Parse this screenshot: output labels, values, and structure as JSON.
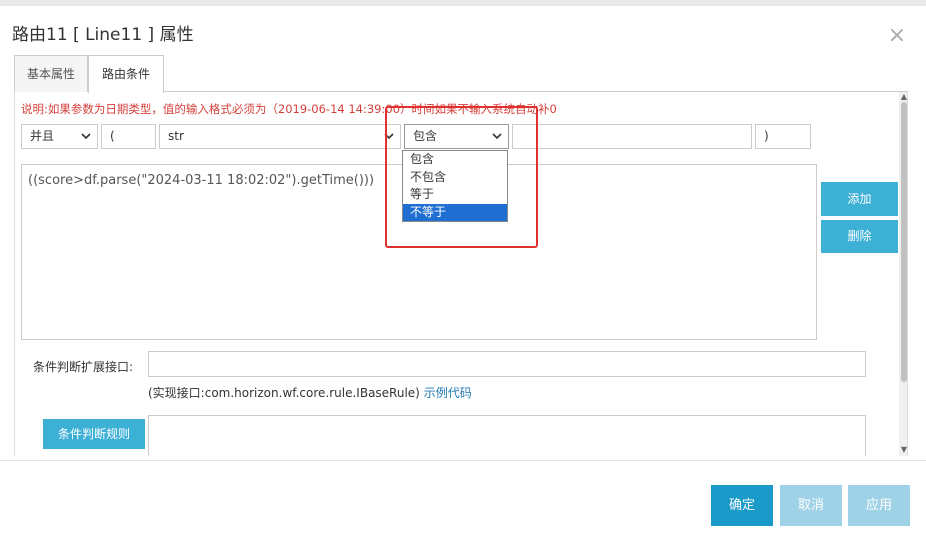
{
  "dialog": {
    "title": "路由11 [ Line11 ] 属性"
  },
  "tabs": [
    {
      "label": "基本属性",
      "active": false
    },
    {
      "label": "路由条件",
      "active": true
    }
  ],
  "note": "说明:如果参数为日期类型，值的输入格式必须为（2019-06-14 14:39:00）时间如果不输入系统自动补0",
  "condition_row": {
    "logic_value": "并且",
    "left_paren": "(",
    "variable_value": "str",
    "operator_value": "包含",
    "compare_value": "",
    "right_paren": ")"
  },
  "operator_options": [
    "包含",
    "不包含",
    "等于",
    "不等于"
  ],
  "operator_highlighted": "不等于",
  "expression_text": "((score>df.parse(\"2024-03-11 18:02:02\").getTime()))",
  "side_buttons": {
    "add": "添加",
    "delete": "删除"
  },
  "extension": {
    "label": "条件判断扩展接口:",
    "value": "",
    "hint": "(实现接口:com.horizon.wf.core.rule.IBaseRule)",
    "hint_link": "示例代码"
  },
  "rule_button": "条件判断规则",
  "footer": {
    "ok": "确定",
    "cancel": "取消",
    "apply": "应用"
  },
  "colors": {
    "primary": "#1a9ac9",
    "accent": "#3db0d6",
    "note_red": "#d43f3a",
    "highlight_box": "#e03030",
    "dropdown_selected": "#1e6fd1"
  }
}
